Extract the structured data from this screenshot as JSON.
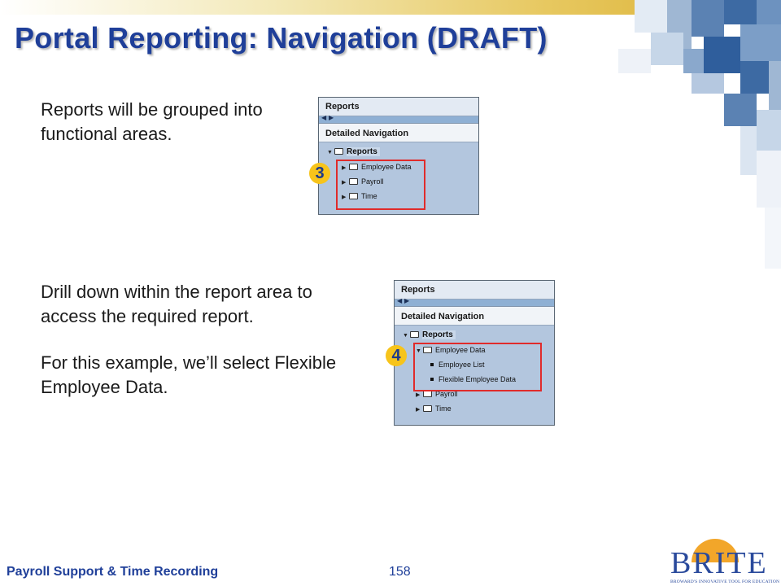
{
  "slide": {
    "title": "Portal Reporting: Navigation (DRAFT)",
    "text_grouped": "Reports will be grouped into functional areas.",
    "text_drill": "Drill down within the report area to access the required report.",
    "text_example": "For this example, we’ll select Flexible Employee Data."
  },
  "panel1": {
    "header": "Reports",
    "subheader": "Detailed Navigation",
    "scroll_left": "◀",
    "scroll_right": "▶",
    "root": "Reports",
    "items": [
      "Employee Data",
      "Payroll",
      "Time"
    ],
    "badge": "3"
  },
  "panel2": {
    "header": "Reports",
    "subheader": "Detailed Navigation",
    "scroll_left": "◀",
    "scroll_right": "▶",
    "root": "Reports",
    "expanded": "Employee Data",
    "children": [
      "Employee List",
      "Flexible Employee Data"
    ],
    "items": [
      "Payroll",
      "Time"
    ],
    "badge": "4"
  },
  "footer": {
    "course": "Payroll Support & Time Recording",
    "page": "158"
  },
  "logo": {
    "name": "BRITE",
    "tagline": "BROWARD'S INNOVATIVE TOOL FOR EDUCATION"
  },
  "colors": {
    "title": "#1f3f99",
    "panel_bg": "#b3c6de",
    "highlight": "#e02b2b",
    "badge": "#f7c41b"
  }
}
